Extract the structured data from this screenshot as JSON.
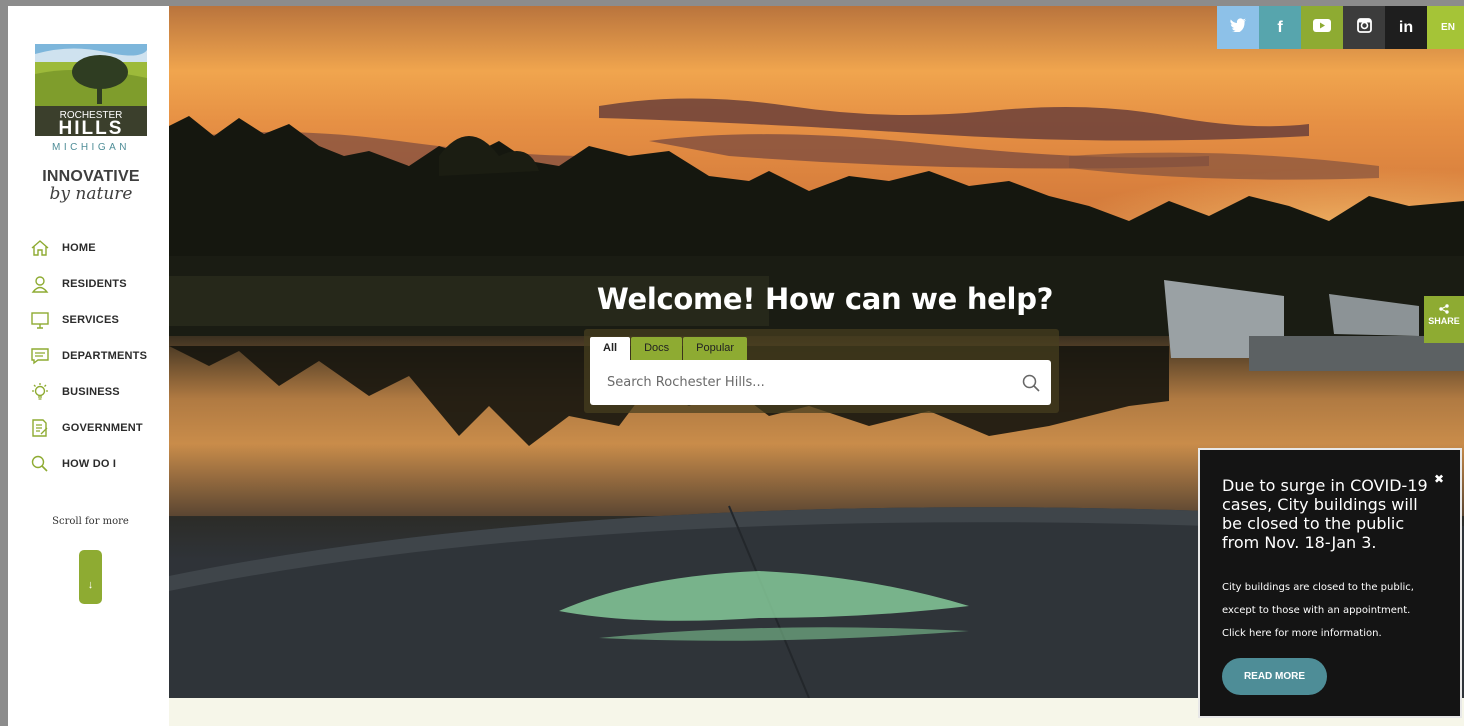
{
  "brand": {
    "name_line1": "ROCHESTER",
    "name_line2": "HILLS",
    "state": "MICHIGAN",
    "tagline_line1": "INNOVATIVE",
    "tagline_line2": "by nature"
  },
  "sidebar": {
    "items": [
      {
        "label": "HOME",
        "icon": "home-icon"
      },
      {
        "label": "RESIDENTS",
        "icon": "person-icon"
      },
      {
        "label": "SERVICES",
        "icon": "monitor-icon"
      },
      {
        "label": "DEPARTMENTS",
        "icon": "chat-icon"
      },
      {
        "label": "BUSINESS",
        "icon": "lightbulb-icon"
      },
      {
        "label": "GOVERNMENT",
        "icon": "document-edit-icon"
      },
      {
        "label": "HOW DO I",
        "icon": "search-icon"
      }
    ],
    "scroll_label": "Scroll for more",
    "scroll_arrow": "↓"
  },
  "social": {
    "items": [
      {
        "name": "twitter",
        "glyph": "🐦",
        "color": "#8dc1e8"
      },
      {
        "name": "facebook",
        "glyph": "f",
        "color": "#57a5ad"
      },
      {
        "name": "youtube",
        "glyph": "▶",
        "color": "#8eab32"
      },
      {
        "name": "instagram",
        "glyph": "◙",
        "color": "#3c3c3c"
      },
      {
        "name": "linkedin",
        "glyph": "in",
        "color": "#1e1e1e"
      },
      {
        "name": "language",
        "glyph": "EN",
        "color": "#a5c437"
      }
    ]
  },
  "hero": {
    "welcome": "Welcome! How can we help?",
    "tabs": [
      "All",
      "Docs",
      "Popular"
    ],
    "search_placeholder": "Search Rochester Hills..."
  },
  "share": {
    "label": "SHARE"
  },
  "popup": {
    "close_glyph": "✖",
    "title": "Due to surge in COVID-19 cases, City buildings will be closed to the public from Nov. 18-Jan 3.",
    "body_lines": [
      "City buildings are closed to the public,",
      "except to those with an appointment.",
      "Click here for more information."
    ],
    "button": "READ MORE"
  },
  "colors": {
    "accent_green": "#8eab32",
    "teal": "#4e8d97",
    "light_blue": "#8dc1e8"
  }
}
